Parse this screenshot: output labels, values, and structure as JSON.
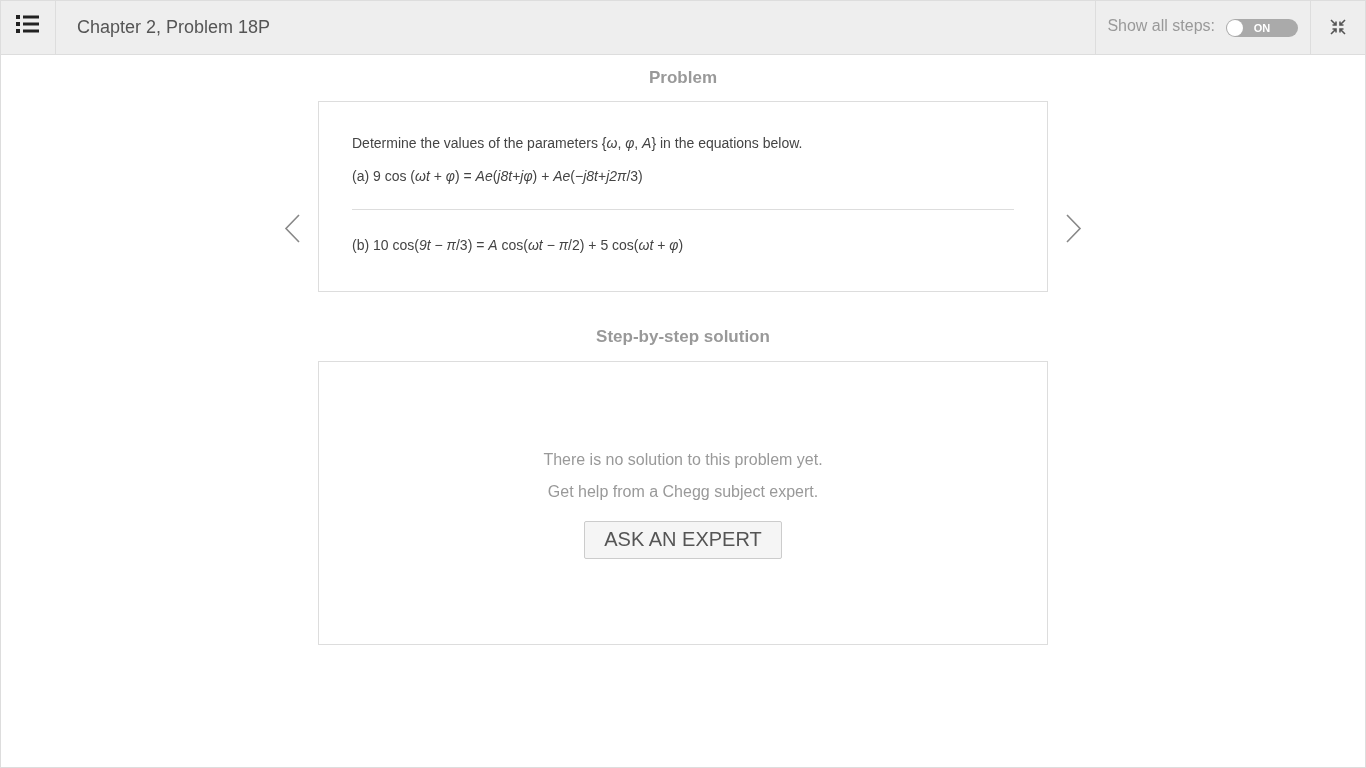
{
  "top_bar": {
    "title": "Chapter 2, Problem 18P",
    "show_all_steps": {
      "label": "Show all steps:",
      "toggle_text": "ON",
      "on": true
    }
  },
  "problem": {
    "heading": "Problem",
    "blocks": [
      {
        "lines": [
          "Determine the values of the parameters {*ω*, *φ*, *A*} in the equations below.",
          "(a) 9 cos (*ωt* + *φ*) = *Ae*(*j8t*+*jφ*) + *Ae*(−*j8t*+*j2π*/3)"
        ]
      },
      {
        "lines": [
          "(b) 10 cos(*9t* − *π*/3) = *A* cos(*ωt* − *π*/2) + 5 cos(*ωt* + *φ*)"
        ]
      }
    ]
  },
  "solution": {
    "heading": "Step-by-step solution",
    "messages": [
      "There is no solution to this problem yet.",
      "Get help from a Chegg subject expert."
    ],
    "button": "ASK AN EXPERT"
  }
}
